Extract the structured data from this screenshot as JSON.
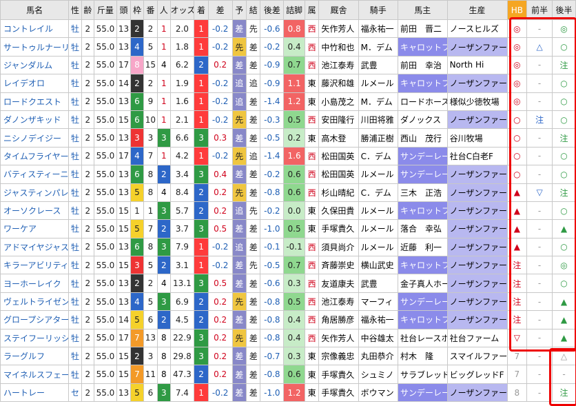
{
  "headers": [
    "馬名",
    "性",
    "齢",
    "斤量",
    "頭",
    "枠",
    "番",
    "人",
    "オッズ",
    "着",
    "差",
    "予",
    "結",
    "後差",
    "詰脚",
    "属",
    "厩舎",
    "騎手",
    "馬主",
    "生産",
    "HB",
    "前半",
    "後半"
  ],
  "rows": [
    {
      "name": "コントレイル",
      "sex": "牡",
      "age": "2",
      "kin": "55.0",
      "to": "13",
      "waku": "2",
      "ban": "2",
      "nin": "1",
      "odds": "2.0",
      "chaku": "1",
      "sa": "-0.2",
      "yo": "差",
      "ke": "先",
      "kosa": "-0.6",
      "tsume": "0.8",
      "zoku": "西",
      "kyu": "矢作芳人",
      "kishu": "福永祐一",
      "owner": "前田　晋二",
      "farm": "ノースヒルズ",
      "hb": "◎",
      "zen": "-",
      "ko": "◎"
    },
    {
      "name": "サートゥルナーリア",
      "sex": "牡",
      "age": "2",
      "kin": "55.0",
      "to": "13",
      "waku": "4",
      "ban": "5",
      "nin": "1",
      "odds": "1.8",
      "chaku": "1",
      "sa": "-0.2",
      "yo": "先",
      "ke": "差",
      "kosa": "-0.2",
      "tsume": "0.4",
      "zoku": "西",
      "kyu": "中竹和也",
      "kishu": "M．デム",
      "owner": "キャロットフ",
      "farm": "ノーザンファーム",
      "hb": "◎",
      "zen": "△",
      "ko": "○"
    },
    {
      "name": "ジャンダルム",
      "sex": "牡",
      "age": "2",
      "kin": "55.0",
      "to": "17",
      "waku": "8",
      "ban": "15",
      "nin": "4",
      "odds": "6.2",
      "chaku": "2",
      "sa": "0.2",
      "yo": "差",
      "ke": "差",
      "kosa": "-0.9",
      "tsume": "0.7",
      "zoku": "西",
      "kyu": "池江泰寿",
      "kishu": "武豊",
      "owner": "前田　幸治",
      "farm": "North Hi",
      "hb": "◎",
      "zen": "-",
      "ko": "注"
    },
    {
      "name": "レイデオロ",
      "sex": "牡",
      "age": "2",
      "kin": "55.0",
      "to": "14",
      "waku": "2",
      "ban": "2",
      "nin": "1",
      "odds": "1.9",
      "chaku": "1",
      "sa": "-0.2",
      "yo": "追",
      "ke": "追",
      "kosa": "-0.9",
      "tsume": "1.1",
      "zoku": "東",
      "kyu": "藤沢和雄",
      "kishu": "ルメール",
      "owner": "キャロットフ",
      "farm": "ノーザンファーム",
      "hb": "◎",
      "zen": "-",
      "ko": "○"
    },
    {
      "name": "ロードクエスト",
      "sex": "牡",
      "age": "2",
      "kin": "55.0",
      "to": "13",
      "waku": "6",
      "ban": "9",
      "nin": "1",
      "odds": "1.6",
      "chaku": "1",
      "sa": "-0.2",
      "yo": "追",
      "ke": "差",
      "kosa": "-1.4",
      "tsume": "1.2",
      "zoku": "東",
      "kyu": "小島茂之",
      "kishu": "M．デム",
      "owner": "ロードホース",
      "farm": "様似少徳牧場",
      "hb": "◎",
      "zen": "-",
      "ko": "○"
    },
    {
      "name": "ダノンザキッド",
      "sex": "牡",
      "age": "2",
      "kin": "55.0",
      "to": "15",
      "waku": "6",
      "ban": "10",
      "nin": "1",
      "odds": "2.1",
      "chaku": "1",
      "sa": "-0.2",
      "yo": "先",
      "ke": "差",
      "kosa": "-0.3",
      "tsume": "0.5",
      "zoku": "西",
      "kyu": "安田隆行",
      "kishu": "川田将雅",
      "owner": "ダノックス",
      "farm": "ノーザンファーム",
      "hb": "○",
      "zen": "注",
      "ko": "○"
    },
    {
      "name": "ニシノデイジー",
      "sex": "牡",
      "age": "2",
      "kin": "55.0",
      "to": "13",
      "waku": "3",
      "ban": "3",
      "nin": "3",
      "odds": "6.6",
      "chaku": "3",
      "sa": "0.3",
      "yo": "差",
      "ke": "差",
      "kosa": "-0.5",
      "tsume": "0.2",
      "zoku": "東",
      "kyu": "高木登",
      "kishu": "勝浦正樹",
      "owner": "西山　茂行",
      "farm": "谷川牧場",
      "hb": "○",
      "zen": "-",
      "ko": "注"
    },
    {
      "name": "タイムフライヤー",
      "sex": "牡",
      "age": "2",
      "kin": "55.0",
      "to": "17",
      "waku": "4",
      "ban": "7",
      "nin": "1",
      "odds": "4.2",
      "chaku": "1",
      "sa": "-0.2",
      "yo": "先",
      "ke": "追",
      "kosa": "-1.4",
      "tsume": "1.6",
      "zoku": "西",
      "kyu": "松田国英",
      "kishu": "C．デム",
      "owner": "サンデーレー",
      "farm": "社台C白老F",
      "hb": "○",
      "zen": "-",
      "ko": "○"
    },
    {
      "name": "バティスティーニ",
      "sex": "牡",
      "age": "2",
      "kin": "55.0",
      "to": "13",
      "waku": "6",
      "ban": "8",
      "nin": "2",
      "odds": "3.4",
      "chaku": "3",
      "sa": "0.4",
      "yo": "差",
      "ke": "差",
      "kosa": "-0.2",
      "tsume": "0.6",
      "zoku": "西",
      "kyu": "松田国英",
      "kishu": "ルメール",
      "owner": "サンデーレー",
      "farm": "ノーザンファーム",
      "hb": "○",
      "zen": "-",
      "ko": "○"
    },
    {
      "name": "ジャスティンパレス",
      "sex": "牡",
      "age": "2",
      "kin": "55.0",
      "to": "13",
      "waku": "5",
      "ban": "8",
      "nin": "4",
      "odds": "8.4",
      "chaku": "2",
      "sa": "0.2",
      "yo": "先",
      "ke": "差",
      "kosa": "-0.8",
      "tsume": "0.6",
      "zoku": "西",
      "kyu": "杉山晴紀",
      "kishu": "C．デム",
      "owner": "三木　正浩",
      "farm": "ノーザンファーム",
      "hb": "▲",
      "zen": "▽",
      "ko": "注"
    },
    {
      "name": "オーソクレース",
      "sex": "牡",
      "age": "2",
      "kin": "55.0",
      "to": "15",
      "waku": "1",
      "ban": "1",
      "nin": "3",
      "odds": "5.7",
      "chaku": "2",
      "sa": "0.2",
      "yo": "追",
      "ke": "先",
      "kosa": "-0.2",
      "tsume": "0.0",
      "zoku": "東",
      "kyu": "久保田貴",
      "kishu": "ルメール",
      "owner": "キャロットフ",
      "farm": "ノーザンファーム",
      "hb": "▲",
      "zen": "-",
      "ko": "○"
    },
    {
      "name": "ワーケア",
      "sex": "牡",
      "age": "2",
      "kin": "55.0",
      "to": "15",
      "waku": "5",
      "ban": "7",
      "nin": "2",
      "odds": "3.7",
      "chaku": "3",
      "sa": "0.5",
      "yo": "差",
      "ke": "差",
      "kosa": "-1.0",
      "tsume": "0.5",
      "zoku": "東",
      "kyu": "手塚貴久",
      "kishu": "ルメール",
      "owner": "落合　幸弘",
      "farm": "ノーザンファーム",
      "hb": "▲",
      "zen": "-",
      "ko": "▲"
    },
    {
      "name": "アドマイヤジャスタ",
      "sex": "牡",
      "age": "2",
      "kin": "55.0",
      "to": "13",
      "waku": "6",
      "ban": "8",
      "nin": "3",
      "odds": "7.9",
      "chaku": "1",
      "sa": "-0.2",
      "yo": "追",
      "ke": "差",
      "kosa": "-0.1",
      "tsume": "-0.1",
      "zoku": "西",
      "kyu": "須貝尚介",
      "kishu": "ルメール",
      "owner": "近藤　利一",
      "farm": "ノーザンファーム",
      "hb": "▲",
      "zen": "-",
      "ko": "○"
    },
    {
      "name": "キラーアビリティ",
      "sex": "牡",
      "age": "2",
      "kin": "55.0",
      "to": "15",
      "waku": "3",
      "ban": "5",
      "nin": "2",
      "odds": "3.1",
      "chaku": "1",
      "sa": "-0.2",
      "yo": "差",
      "ke": "先",
      "kosa": "-0.5",
      "tsume": "0.7",
      "zoku": "西",
      "kyu": "斉藤崇史",
      "kishu": "横山武史",
      "owner": "キャロットフ",
      "farm": "ノーザンファーム",
      "hb": "注",
      "zen": "-",
      "ko": "◎"
    },
    {
      "name": "ヨーホーレイク",
      "sex": "牡",
      "age": "2",
      "kin": "55.0",
      "to": "13",
      "waku": "2",
      "ban": "2",
      "nin": "4",
      "odds": "13.1",
      "chaku": "3",
      "sa": "0.5",
      "yo": "差",
      "ke": "差",
      "kosa": "-0.6",
      "tsume": "0.3",
      "zoku": "西",
      "kyu": "友道康夫",
      "kishu": "武豊",
      "owner": "金子真人ホー",
      "farm": "ノーザンファーム",
      "hb": "注",
      "zen": "-",
      "ko": "○"
    },
    {
      "name": "ヴェルトライゼンデ",
      "sex": "牡",
      "age": "2",
      "kin": "55.0",
      "to": "13",
      "waku": "4",
      "ban": "5",
      "nin": "3",
      "odds": "6.9",
      "chaku": "2",
      "sa": "0.2",
      "yo": "先",
      "ke": "差",
      "kosa": "-0.8",
      "tsume": "0.5",
      "zoku": "西",
      "kyu": "池江泰寿",
      "kishu": "マーフィ",
      "owner": "サンデーレー",
      "farm": "ノーザンファーム",
      "hb": "注",
      "zen": "-",
      "ko": "▲"
    },
    {
      "name": "グロープシアター",
      "sex": "牡",
      "age": "2",
      "kin": "55.0",
      "to": "14",
      "waku": "5",
      "ban": "6",
      "nin": "2",
      "odds": "4.5",
      "chaku": "2",
      "sa": "0.2",
      "yo": "差",
      "ke": "差",
      "kosa": "-0.8",
      "tsume": "0.4",
      "zoku": "西",
      "kyu": "角居勝彦",
      "kishu": "福永祐一",
      "owner": "キャロットフ",
      "farm": "ノーザンファーム",
      "hb": "注",
      "zen": "-",
      "ko": "▲"
    },
    {
      "name": "ステイフーリッシュ",
      "sex": "牡",
      "age": "2",
      "kin": "55.0",
      "to": "17",
      "waku": "7",
      "ban": "13",
      "nin": "8",
      "odds": "22.9",
      "chaku": "3",
      "sa": "0.2",
      "yo": "先",
      "ke": "差",
      "kosa": "-0.8",
      "tsume": "0.4",
      "zoku": "西",
      "kyu": "矢作芳人",
      "kishu": "中谷雄太",
      "owner": "社台レースホ",
      "farm": "社台ファーム",
      "hb": "▽",
      "zen": "-",
      "ko": "▲"
    },
    {
      "name": "ラーグルフ",
      "sex": "牡",
      "age": "2",
      "kin": "55.0",
      "to": "15",
      "waku": "2",
      "ban": "3",
      "nin": "8",
      "odds": "29.8",
      "chaku": "3",
      "sa": "0.2",
      "yo": "差",
      "ke": "差",
      "kosa": "-0.7",
      "tsume": "0.3",
      "zoku": "東",
      "kyu": "宗像義忠",
      "kishu": "丸田恭介",
      "owner": "村木　隆",
      "farm": "スマイルファーム",
      "hb": "7",
      "zen": "-",
      "ko": "△"
    },
    {
      "name": "マイネルスフェーン",
      "sex": "牡",
      "age": "2",
      "kin": "55.0",
      "to": "15",
      "waku": "7",
      "ban": "11",
      "nin": "8",
      "odds": "47.3",
      "chaku": "2",
      "sa": "0.2",
      "yo": "差",
      "ke": "差",
      "kosa": "-0.8",
      "tsume": "0.6",
      "zoku": "東",
      "kyu": "手塚貴久",
      "kishu": "シュミノ",
      "owner": "サラブレッド",
      "farm": "ビッグレッドF",
      "hb": "7",
      "zen": "-",
      "ko": "-"
    },
    {
      "name": "ハートレー",
      "sex": "セ",
      "age": "2",
      "kin": "55.0",
      "to": "13",
      "waku": "5",
      "ban": "6",
      "nin": "3",
      "odds": "7.4",
      "chaku": "1",
      "sa": "-0.2",
      "yo": "差",
      "ke": "差",
      "kosa": "-1.0",
      "tsume": "1.2",
      "zoku": "東",
      "kyu": "手塚貴久",
      "kishu": "ボウマン",
      "owner": "サンデーレー",
      "farm": "ノーザンファーム",
      "hb": "8",
      "zen": "-",
      "ko": "注"
    }
  ]
}
